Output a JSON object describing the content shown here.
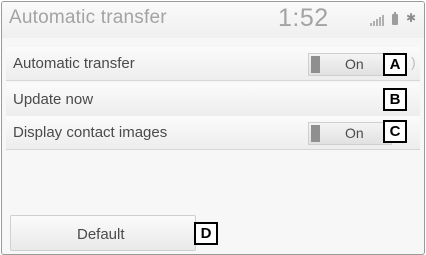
{
  "header": {
    "title": "Automatic transfer",
    "clock": "1:52",
    "status_icons": [
      "signal-icon",
      "battery-icon",
      "bluetooth-icon"
    ]
  },
  "settings": [
    {
      "label": "Automatic transfer",
      "toggle": "On",
      "callout": "A"
    },
    {
      "label": "Update now",
      "callout": "B"
    },
    {
      "label": "Display contact images",
      "toggle": "On",
      "callout": "C"
    }
  ],
  "default_button": {
    "label": "Default",
    "callout": "D"
  },
  "colors": {
    "accent": "#8f8f8f",
    "title_text": "#a3a3a3",
    "body_text": "#4a4a4a"
  }
}
